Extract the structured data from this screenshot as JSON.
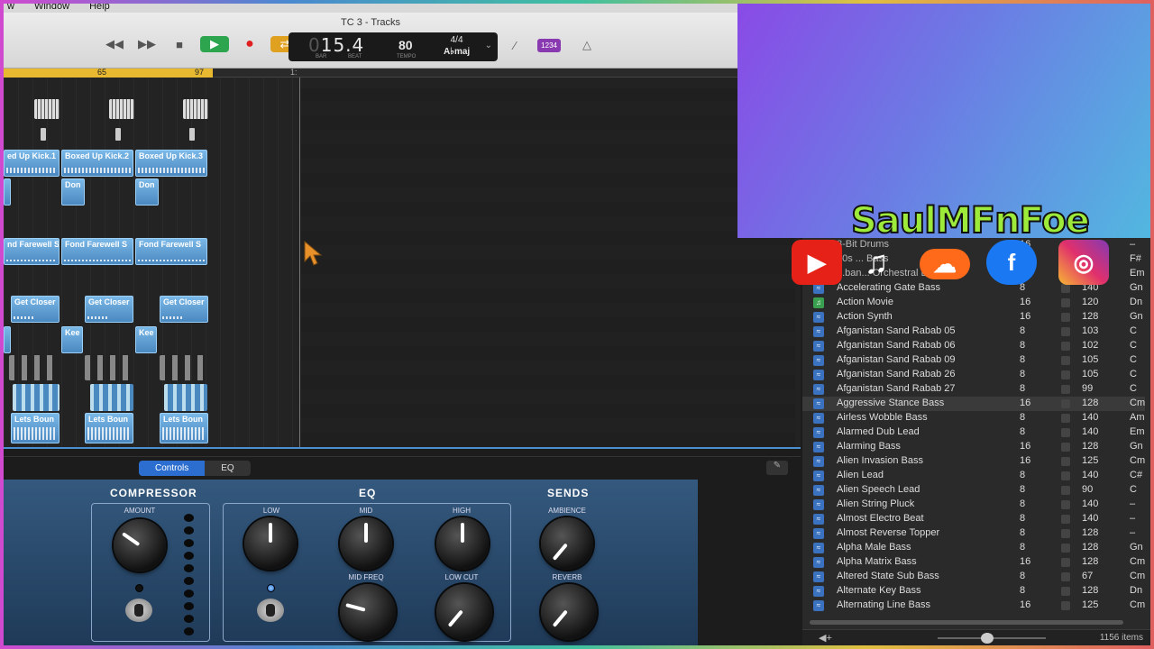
{
  "menubar": {
    "items": [
      "w",
      "Window",
      "Help"
    ]
  },
  "window": {
    "title": "TC 3 - Tracks"
  },
  "transport": {
    "position": "15.4",
    "position_prefix": "0",
    "bar_label": "BAR",
    "beat_label": "BEAT",
    "tempo": "80",
    "tempo_label": "TEMPO",
    "signature": "4/4",
    "key": "A♭maj",
    "count_in": "1234"
  },
  "ruler": {
    "marks": [
      "65",
      "97",
      "1:"
    ]
  },
  "regions": {
    "kick": [
      "ed Up Kick.1",
      "Boxed Up Kick.2",
      "Boxed Up Kick.3"
    ],
    "don": [
      "Don",
      "Don"
    ],
    "fond": [
      "nd Farewell S",
      "Fond Farewell S",
      "Fond Farewell S"
    ],
    "closer": [
      "Get Closer",
      "Get Closer",
      "Get Closer"
    ],
    "kee": [
      "Kee",
      "Kee"
    ],
    "bounce": [
      "Lets Boun",
      "Lets Boun",
      "Lets Boun"
    ]
  },
  "smart_controls": {
    "tabs": [
      "Controls",
      "EQ"
    ],
    "compressor": {
      "title": "COMPRESSOR",
      "amount": "AMOUNT",
      "amount_value": 0.3
    },
    "eq": {
      "title": "EQ",
      "low": "LOW",
      "mid": "MID",
      "high": "HIGH",
      "mid_freq": "MID FREQ",
      "low_cut": "LOW CUT"
    },
    "sends": {
      "title": "SENDS",
      "ambience": "AMBIENCE",
      "reverb": "REVERB"
    }
  },
  "overlay": {
    "brand": "SaulMFnFoe",
    "social": [
      "youtube-icon",
      "apple-music-icon",
      "soundcloud-icon",
      "facebook-icon",
      "instagram-icon"
    ],
    "colors": {
      "youtube": "#e62117",
      "soundcloud": "#ff6a1a",
      "facebook": "#1a78f2",
      "instagram": "#c13584"
    }
  },
  "loops": {
    "partial_rows": [
      {
        "name": "8-Bit Drums",
        "beats": "16",
        "tempo": "",
        "key": "–"
      },
      {
        "name": "80s ... Bass",
        "beats": "",
        "tempo": "",
        "key": "F#"
      },
      {
        "name": "...ban... Orchestral Layers",
        "beats": "",
        "tempo": "",
        "key": "Em"
      }
    ],
    "rows": [
      {
        "name": "Accelerating Gate Bass",
        "beats": "8",
        "tempo": "140",
        "key": "Gn",
        "type": "audio"
      },
      {
        "name": "Action Movie",
        "beats": "16",
        "tempo": "120",
        "key": "Dn",
        "type": "midi"
      },
      {
        "name": "Action Synth",
        "beats": "16",
        "tempo": "128",
        "key": "Gn",
        "type": "audio"
      },
      {
        "name": "Afganistan Sand Rabab 05",
        "beats": "8",
        "tempo": "103",
        "key": "C",
        "type": "audio"
      },
      {
        "name": "Afganistan Sand Rabab 06",
        "beats": "8",
        "tempo": "102",
        "key": "C",
        "type": "audio"
      },
      {
        "name": "Afganistan Sand Rabab 09",
        "beats": "8",
        "tempo": "105",
        "key": "C",
        "type": "audio"
      },
      {
        "name": "Afganistan Sand Rabab 26",
        "beats": "8",
        "tempo": "105",
        "key": "C",
        "type": "audio"
      },
      {
        "name": "Afganistan Sand Rabab 27",
        "beats": "8",
        "tempo": "99",
        "key": "C",
        "type": "audio"
      },
      {
        "name": "Aggressive Stance Bass",
        "beats": "16",
        "tempo": "128",
        "key": "Cm",
        "type": "audio"
      },
      {
        "name": "Airless Wobble Bass",
        "beats": "8",
        "tempo": "140",
        "key": "Am",
        "type": "audio"
      },
      {
        "name": "Alarmed Dub Lead",
        "beats": "8",
        "tempo": "140",
        "key": "Em",
        "type": "audio"
      },
      {
        "name": "Alarming Bass",
        "beats": "16",
        "tempo": "128",
        "key": "Gn",
        "type": "audio"
      },
      {
        "name": "Alien Invasion Bass",
        "beats": "16",
        "tempo": "125",
        "key": "Cm",
        "type": "audio"
      },
      {
        "name": "Alien Lead",
        "beats": "8",
        "tempo": "140",
        "key": "C#",
        "type": "audio"
      },
      {
        "name": "Alien Speech Lead",
        "beats": "8",
        "tempo": "90",
        "key": "C",
        "type": "audio"
      },
      {
        "name": "Alien String Pluck",
        "beats": "8",
        "tempo": "140",
        "key": "–",
        "type": "audio"
      },
      {
        "name": "Almost Electro Beat",
        "beats": "8",
        "tempo": "140",
        "key": "–",
        "type": "audio"
      },
      {
        "name": "Almost Reverse Topper",
        "beats": "8",
        "tempo": "128",
        "key": "–",
        "type": "audio"
      },
      {
        "name": "Alpha Male Bass",
        "beats": "8",
        "tempo": "128",
        "key": "Gn",
        "type": "audio"
      },
      {
        "name": "Alpha Matrix Bass",
        "beats": "16",
        "tempo": "128",
        "key": "Cm",
        "type": "audio"
      },
      {
        "name": "Altered State Sub Bass",
        "beats": "8",
        "tempo": "67",
        "key": "Cm",
        "type": "audio"
      },
      {
        "name": "Alternate Key Bass",
        "beats": "8",
        "tempo": "128",
        "key": "Dn",
        "type": "audio"
      },
      {
        "name": "Alternating Line Bass",
        "beats": "16",
        "tempo": "125",
        "key": "Cm",
        "type": "audio"
      }
    ],
    "selected_index": 8,
    "item_count": "1156 items"
  }
}
